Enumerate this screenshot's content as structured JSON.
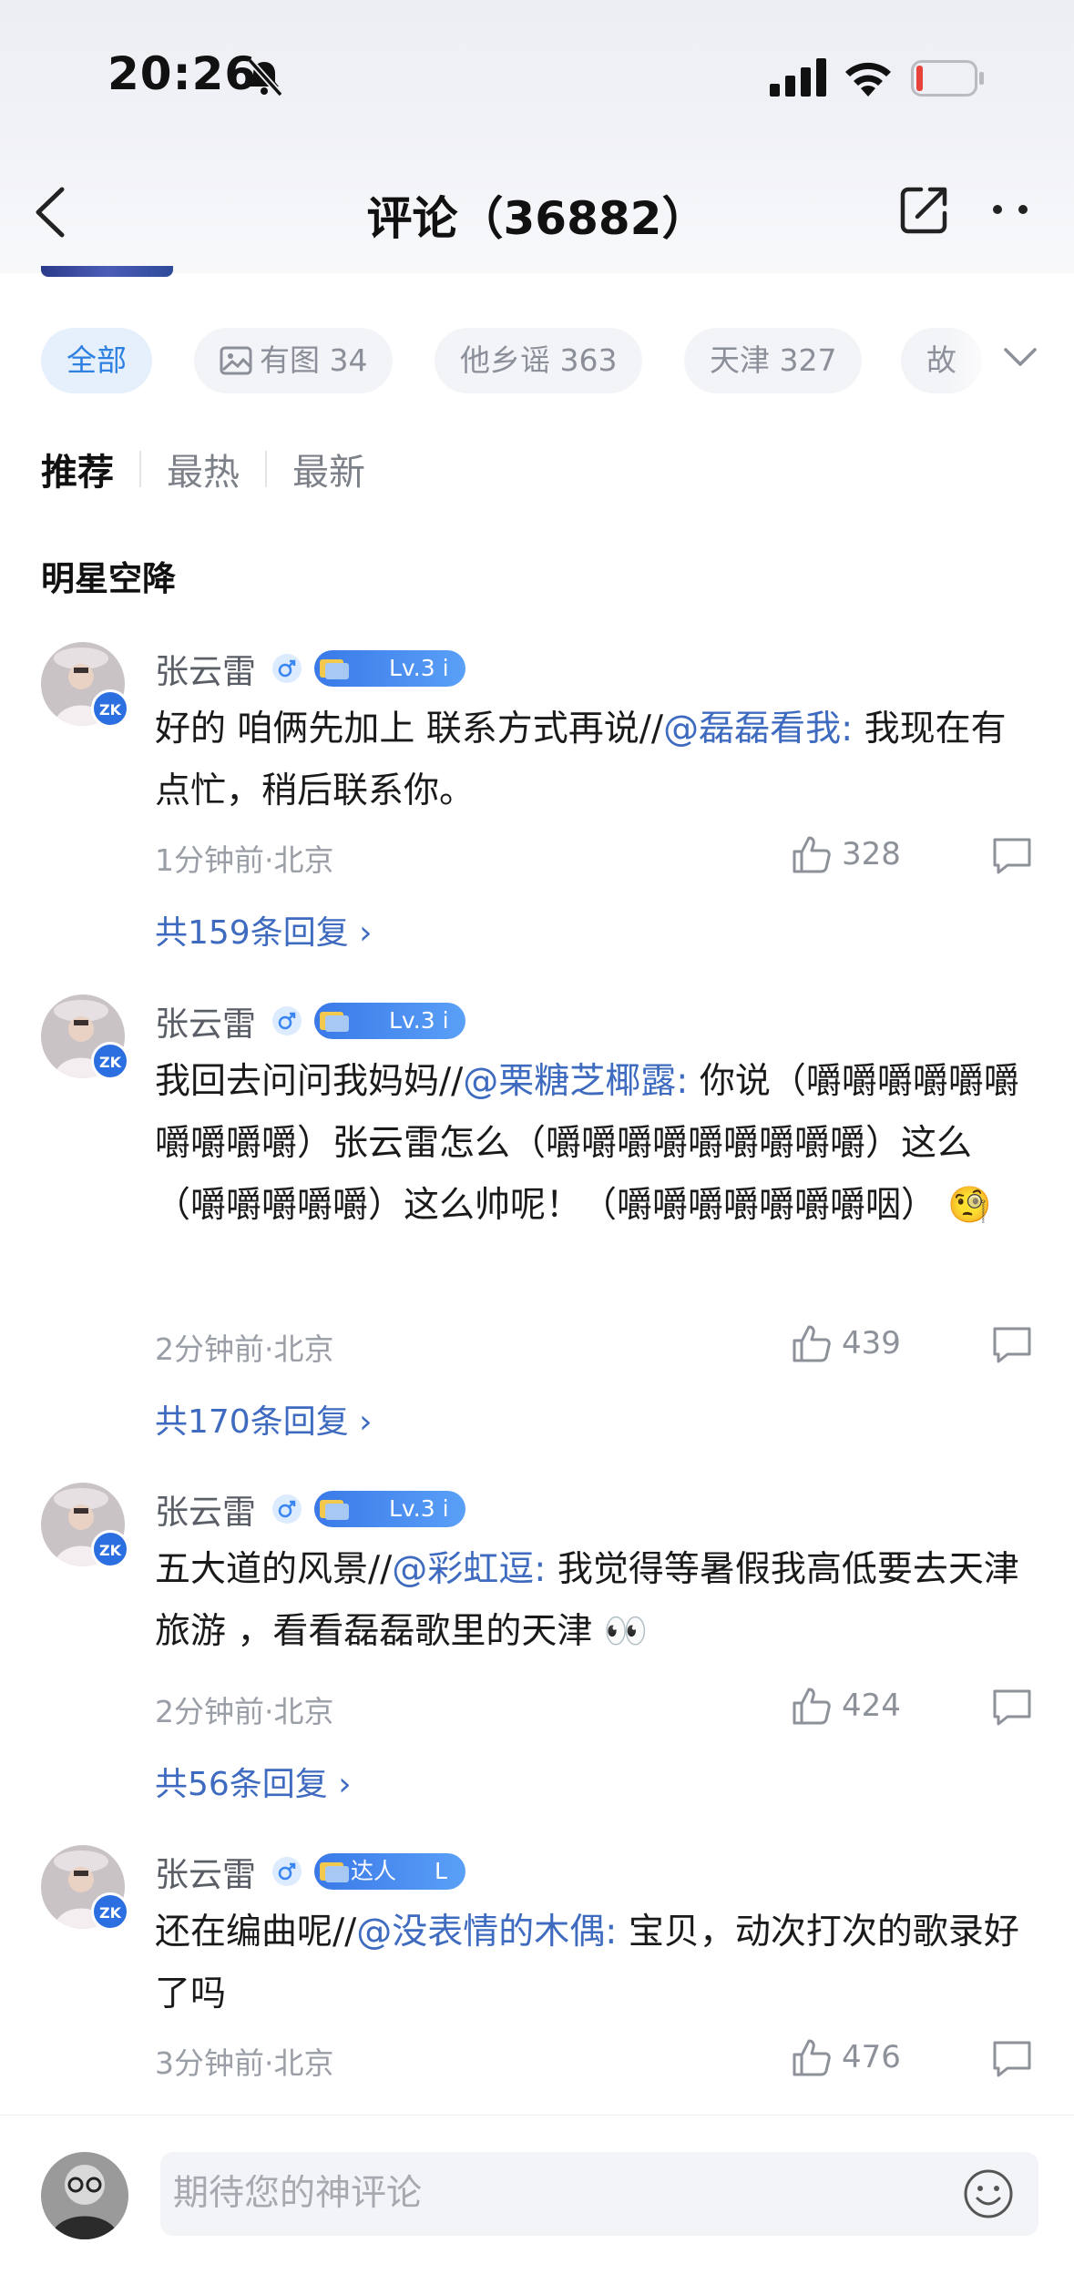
{
  "status_bar": {
    "time": "20:26"
  },
  "nav": {
    "title": "评论（36882）"
  },
  "filters": [
    {
      "label": "全部"
    },
    {
      "label": "有图 34"
    },
    {
      "label": "他乡谣 363"
    },
    {
      "label": "天津 327"
    },
    {
      "label": "故"
    }
  ],
  "sort_tabs": [
    "推荐",
    "最热",
    "最新"
  ],
  "section_title": "明星空降",
  "comments": [
    {
      "user": "张云雷",
      "level": "Lv.3",
      "level_suffix": "i",
      "text_a": "好的 咱俩先加上 联系方式再说//",
      "mention": "@磊磊看我:",
      "text_b": " 我现在有点忙，稍后联系你。",
      "meta": "1分钟前·北京",
      "likes": "328",
      "replies": "共159条回复 ›"
    },
    {
      "user": "张云雷",
      "level": "Lv.3",
      "level_suffix": "i",
      "text_a": "我回去问问我妈妈//",
      "mention": "@栗糖芝椰露:",
      "text_b": " 你说（嚼嚼嚼嚼嚼嚼嚼嚼嚼嚼）张云雷怎么（嚼嚼嚼嚼嚼嚼嚼嚼嚼）这么（嚼嚼嚼嚼嚼）这么帅呢！（嚼嚼嚼嚼嚼嚼嚼咽）",
      "emoji": "🧐",
      "meta": "2分钟前·北京",
      "likes": "439",
      "replies": "共170条回复 ›"
    },
    {
      "user": "张云雷",
      "level": "Lv.3",
      "level_suffix": "i",
      "text_a": "五大道的风景//",
      "mention": "@彩虹逗:",
      "text_b": " 我觉得等暑假我高低要去天津旅游 ，看看磊磊歌里的天津 ",
      "emoji": "👀",
      "meta": "2分钟前·北京",
      "likes": "424",
      "replies": "共56条回复 ›"
    },
    {
      "user": "张云雷",
      "level": "达人",
      "level_suffix": "L",
      "text_a": "还在编曲呢//",
      "mention": "@没表情的木偶:",
      "text_b": " 宝贝，动次打次的歌录好了吗",
      "meta": "3分钟前·北京",
      "likes": "476"
    }
  ],
  "bottom": {
    "input_placeholder": "期待您的神评论"
  }
}
